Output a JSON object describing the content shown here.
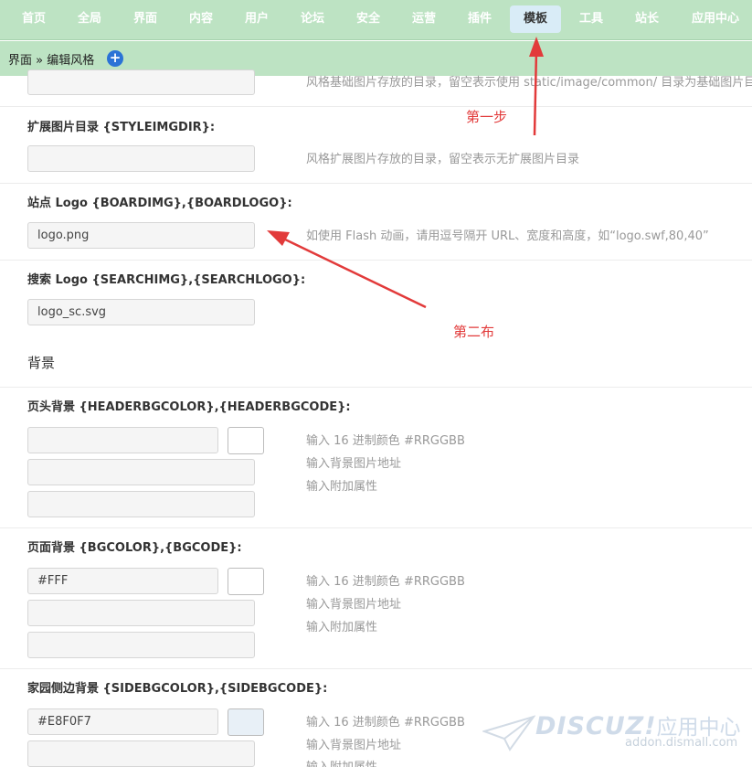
{
  "nav": {
    "items": [
      {
        "label": "首页",
        "active": false
      },
      {
        "label": "全局",
        "active": false
      },
      {
        "label": "界面",
        "active": false
      },
      {
        "label": "内容",
        "active": false
      },
      {
        "label": "用户",
        "active": false
      },
      {
        "label": "论坛",
        "active": false
      },
      {
        "label": "安全",
        "active": false
      },
      {
        "label": "运营",
        "active": false
      },
      {
        "label": "插件",
        "active": false
      },
      {
        "label": "模板",
        "active": true
      },
      {
        "label": "工具",
        "active": false
      },
      {
        "label": "站长",
        "active": false
      },
      {
        "label": "应用中心",
        "active": false
      }
    ]
  },
  "breadcrumb": {
    "text": "界面 » 编辑风格",
    "add_icon": "+"
  },
  "form": {
    "imgdir": {
      "hint": "风格基础图片存放的目录，留空表示使用 static/image/common/ 目录为基础图片目录"
    },
    "styleimgdir": {
      "label": "扩展图片目录 {STYLEIMGDIR}:",
      "value": "",
      "hint": "风格扩展图片存放的目录，留空表示无扩展图片目录"
    },
    "boardimg": {
      "label": "站点 Logo {BOARDIMG},{BOARDLOGO}:",
      "value": "logo.png",
      "hint": "如使用 Flash 动画，请用逗号隔开 URL、宽度和高度，如“logo.swf,80,40”"
    },
    "searchimg": {
      "label": "搜索 Logo {SEARCHIMG},{SEARCHLOGO}:",
      "value": "logo_sc.svg"
    },
    "background_section": "背景",
    "headerbg": {
      "label": "页头背景 {HEADERBGCOLOR},{HEADERBGCODE}:",
      "color_value": "",
      "swatch_color": "#FFFFFF",
      "image_value": "",
      "extra_value": "",
      "hints": [
        "输入 16 进制颜色 #RRGGBB",
        "输入背景图片地址",
        "输入附加属性"
      ]
    },
    "bg": {
      "label": "页面背景 {BGCOLOR},{BGCODE}:",
      "color_value": "#FFF",
      "swatch_color": "#FFFFFF",
      "image_value": "",
      "extra_value": "",
      "hints": [
        "输入 16 进制颜色 #RRGGBB",
        "输入背景图片地址",
        "输入附加属性"
      ]
    },
    "sidebg": {
      "label": "家园侧边背景 {SIDEBGCOLOR},{SIDEBGCODE}:",
      "color_value": "#E8F0F7",
      "swatch_color": "#E8F0F7",
      "image_value": "",
      "hints": [
        "输入 16 进制颜色 #RRGGBB",
        "输入背景图片地址",
        "输入附加属性"
      ]
    }
  },
  "annotations": {
    "step1": "第一步",
    "step2": "第二布"
  },
  "watermark": {
    "logo": "DISCUZ!",
    "logo_cn": "应用中心",
    "url": "addon.dismall.com"
  },
  "colors": {
    "nav_bg": "#bde3c3",
    "nav_active_bg": "#d9ecf7",
    "annotation_red": "#e23a3a",
    "add_icon_blue": "#2b73d6"
  }
}
